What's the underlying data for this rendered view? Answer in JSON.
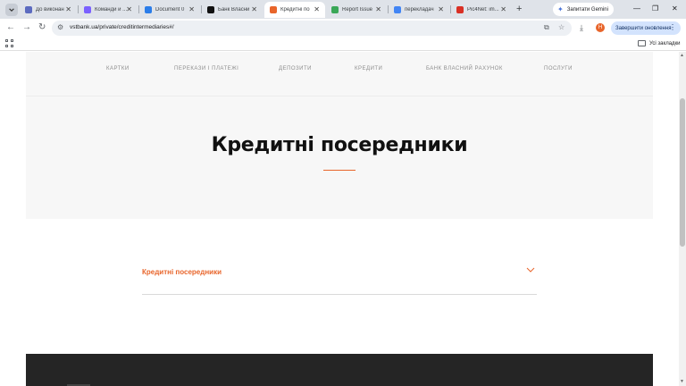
{
  "browser": {
    "tabs": [
      {
        "title": "До виконан",
        "color": "#5c6bc0"
      },
      {
        "title": "Команди и ...",
        "color": "#7b61ff"
      },
      {
        "title": "Document 0",
        "color": "#2b7de9"
      },
      {
        "title": "Банк Власни",
        "color": "#111111"
      },
      {
        "title": "Кредитні по",
        "color": "#e8652b",
        "active": true
      },
      {
        "title": "Report Issue",
        "color": "#3aa757"
      },
      {
        "title": "перекладач",
        "color": "#4285f4"
      },
      {
        "title": "Pic4Net: im...",
        "color": "#d93025"
      }
    ],
    "new_tab": "+",
    "gemini_label": "Запитати Gemini",
    "window_controls": [
      "—",
      "❐",
      "✕"
    ],
    "url": "vstbank.ua/private/creditintermediaries#/",
    "profile_initial": "Н",
    "update_label": "Завершити оновлення",
    "bookmarks_all": "Усі закладки"
  },
  "page": {
    "menu": [
      "КАРТКИ",
      "ПЕРЕКАЗИ І ПЛАТЕЖІ",
      "ДЕПОЗИТИ",
      "КРЕДИТИ",
      "БАНК ВЛАСНИЙ РАХУНОК",
      "ПОСЛУГИ"
    ],
    "title": "Кредитні посередники",
    "accordion_label": "Кредитні посередники"
  },
  "colors": {
    "accent": "#e8652b",
    "footer": "#252525",
    "band": "#f7f7f7"
  }
}
